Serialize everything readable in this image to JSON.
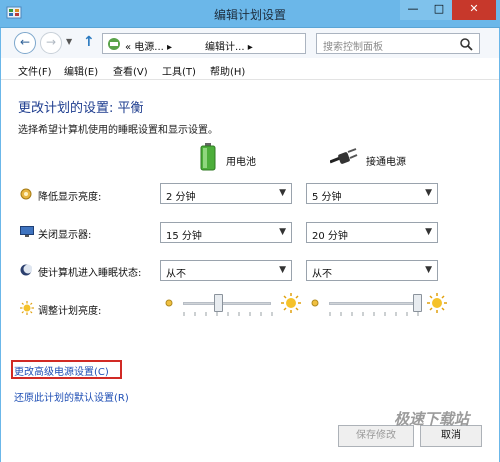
{
  "window": {
    "title": "编辑计划设置",
    "minimize_label": "—",
    "maximize_label": "□",
    "close_label": "✕"
  },
  "nav": {
    "back_label": "←",
    "forward_label": "→",
    "up_label": "↑",
    "breadcrumbs": [
      "« 电源... ▸",
      "编辑计... ▸"
    ],
    "refresh_label": "↻",
    "search_placeholder": "搜索控制面板"
  },
  "menu": [
    "文件(F)",
    "编辑(E)",
    "查看(V)",
    "工具(T)",
    "帮助(H)"
  ],
  "heading": "更改计划的设置: 平衡",
  "subtitle": "选择希望计算机使用的睡眠设置和显示设置。",
  "columns": {
    "battery": "用电池",
    "plugged": "接通电源"
  },
  "settings": [
    {
      "label": "降低显示亮度:",
      "icon": "dim-display-icon",
      "battery": "2 分钟",
      "plugged": "5 分钟"
    },
    {
      "label": "关闭显示器:",
      "icon": "monitor-icon",
      "battery": "15 分钟",
      "plugged": "20 分钟"
    },
    {
      "label": "使计算机进入睡眠状态:",
      "icon": "moon-icon",
      "battery": "从不",
      "plugged": "从不"
    }
  ],
  "brightness": {
    "label": "调整计划亮度:",
    "battery_level": 0.4,
    "plugged_level": 1.0
  },
  "links": {
    "advanced": "更改高级电源设置(C)",
    "restore": "还原此计划的默认设置(R)"
  },
  "buttons": {
    "save": "保存修改",
    "cancel": "取消"
  },
  "watermark": "极速下载站",
  "colors": {
    "titlebar": "#6bb7e9",
    "link": "#1f4fb5",
    "heading": "#1e3d8f",
    "highlight_border": "#d12a25"
  }
}
